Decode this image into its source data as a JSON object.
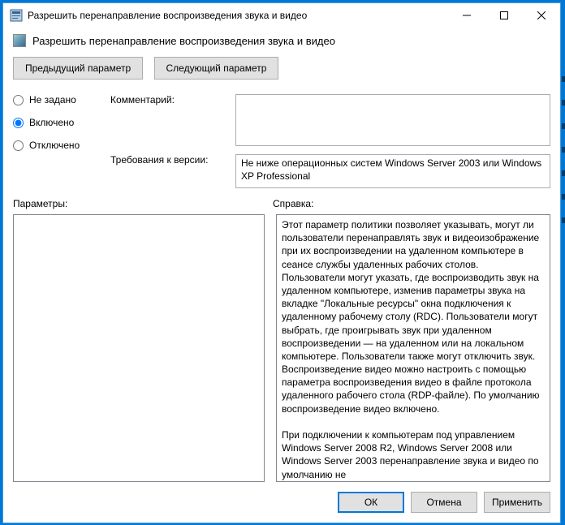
{
  "window": {
    "title": "Разрешить перенаправление воспроизведения звука и видео"
  },
  "header": {
    "title": "Разрешить перенаправление воспроизведения звука и видео"
  },
  "nav": {
    "prev": "Предыдущий параметр",
    "next": "Следующий параметр"
  },
  "state": {
    "options": {
      "not_configured": "Не задано",
      "enabled": "Включено",
      "disabled": "Отключено"
    },
    "selected": "enabled"
  },
  "fields": {
    "comment_label": "Комментарий:",
    "comment_value": "",
    "requirements_label": "Требования к версии:",
    "requirements_value": "Не ниже операционных систем Windows Server 2003 или Windows XP Professional"
  },
  "panelsLabel": {
    "params": "Параметры:",
    "help": "Справка:"
  },
  "help_text": "Этот параметр политики позволяет указывать, могут ли пользователи перенаправлять звук и видеоизображение при их воспроизведении на удаленном компьютере в сеансе службы удаленных рабочих столов.\nПользователи могут указать, где воспроизводить звук на удаленном компьютере, изменив параметры звука на вкладке \"Локальные ресурсы\" окна подключения к удаленному рабочему столу (RDC). Пользователи могут выбрать, где проигрывать звук при удаленном воспроизведении — на удаленном или на локальном компьютере. Пользователи также могут отключить звук. Воспроизведение видео можно настроить с помощью параметра воспроизведения видео в файле протокола удаленного рабочего стола (RDP-файле). По умолчанию воспроизведение видео включено.\n\nПри подключении к компьютерам под управлением Windows Server 2008 R2, Windows Server 2008 или Windows Server 2003 перенаправление звука и видео по умолчанию не",
  "footer": {
    "ok": "ОК",
    "cancel": "Отмена",
    "apply": "Применить"
  }
}
